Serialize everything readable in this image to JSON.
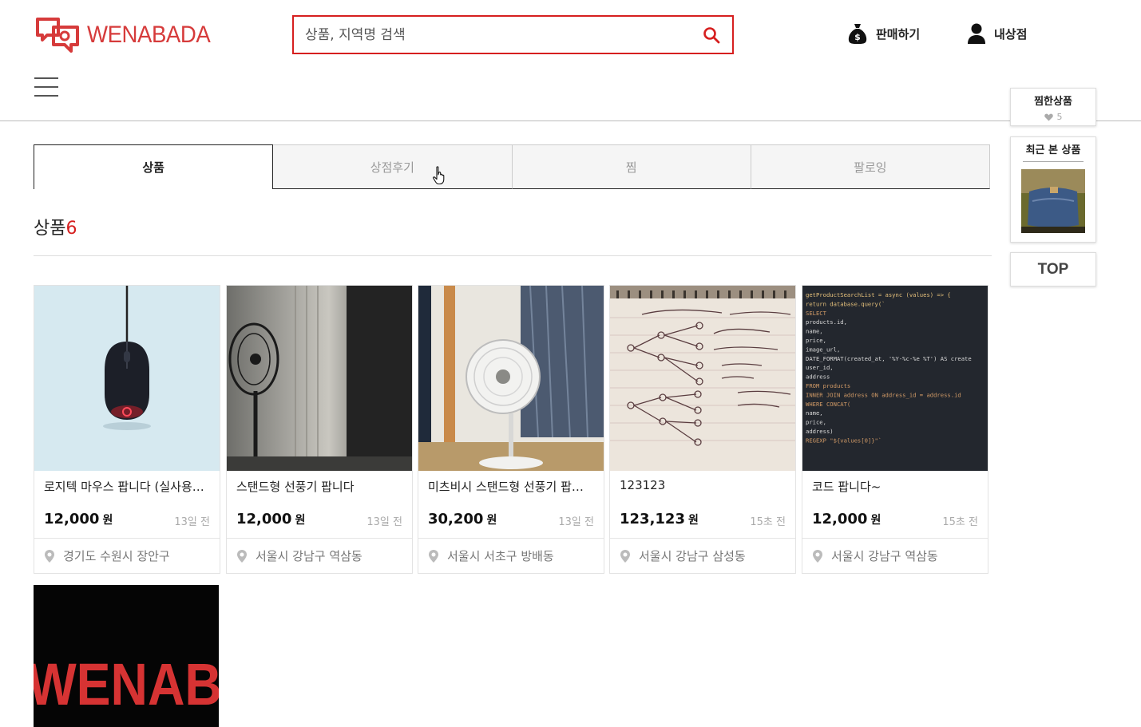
{
  "brand": {
    "name": "WENABADA",
    "accent": "#d61f1f"
  },
  "search": {
    "placeholder": "상품, 지역명 검색"
  },
  "header": {
    "sell_label": "판매하기",
    "mystore_label": "내상점"
  },
  "tabs": [
    {
      "label": "상품",
      "active": true
    },
    {
      "label": "상점후기",
      "active": false
    },
    {
      "label": "찜",
      "active": false
    },
    {
      "label": "팔로잉",
      "active": false
    }
  ],
  "section": {
    "title": "상품",
    "count": "6"
  },
  "products": [
    {
      "name": "로지텍 마우스 팝니다 (실사용 1달)",
      "price": "12,000",
      "unit": "원",
      "time": "13일 전",
      "location": "경기도 수원시 장안구",
      "thumb": "mouse"
    },
    {
      "name": "스탠드형 선풍기 팝니다",
      "price": "12,000",
      "unit": "원",
      "time": "13일 전",
      "location": "서울시 강남구 역삼동",
      "thumb": "fan-dark"
    },
    {
      "name": "미츠비시 스탠드형 선풍기 팝니다",
      "price": "30,200",
      "unit": "원",
      "time": "13일 전",
      "location": "서울시 서초구 방배동",
      "thumb": "fan-white"
    },
    {
      "name": "123123",
      "price": "123,123",
      "unit": "원",
      "time": "15초 전",
      "location": "서울시 강남구 삼성동",
      "thumb": "notebook"
    },
    {
      "name": "코드 팝니다~",
      "price": "12,000",
      "unit": "원",
      "time": "15초 전",
      "location": "서울시 강남구 역삼동",
      "thumb": "code"
    },
    {
      "thumb": "logo-banner"
    }
  ],
  "code_lines": [
    "getProductSearchList = async (values) => {",
    "return database.query(`",
    "  SELECT",
    "    products.id,",
    "    name,",
    "    price,",
    "    image_url,",
    "    DATE_FORMAT(created_at, '%Y-%c-%e %T') AS create",
    "    user_id,",
    "    address",
    "  FROM products",
    "  INNER JOIN address ON address_id = address.id",
    "  WHERE CONCAT(",
    "    name,",
    "    price,",
    "    address)",
    "  REGEXP \"${values[0]}\"`"
  ],
  "banner_text": "WENAB",
  "sidebar": {
    "wish_title": "찜한상품",
    "wish_count": "5",
    "recent_title": "최근 본 상품",
    "top_label": "TOP"
  },
  "icons": {
    "search": "search-icon",
    "sell": "money-bag-icon",
    "store": "user-icon",
    "location": "location-pin-icon",
    "heart": "heart-icon",
    "menu": "hamburger-menu-icon"
  }
}
